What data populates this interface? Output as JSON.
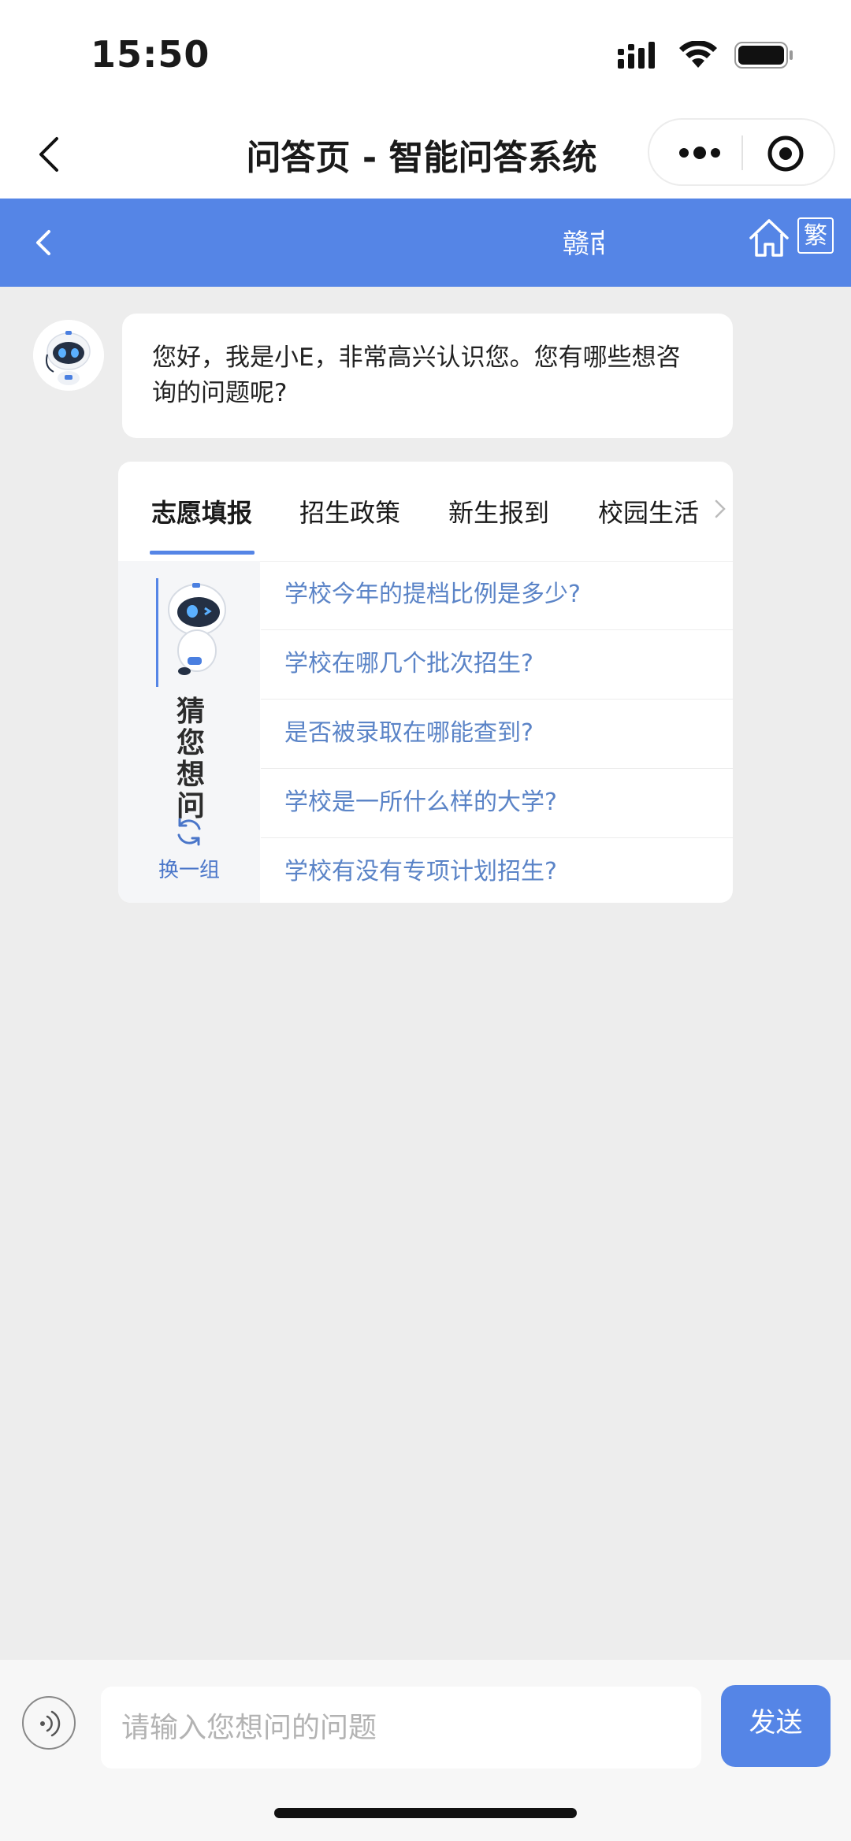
{
  "status_bar": {
    "time": "15:50"
  },
  "nav": {
    "title": "问答页 - 智能问答系统"
  },
  "banner": {
    "title": "赣南",
    "traditional_label": "繁"
  },
  "welcome": {
    "message": "您好，我是小E，非常高兴认识您。您有哪些想咨询的问题呢?"
  },
  "card": {
    "tabs": [
      {
        "label": "志愿填报",
        "active": true
      },
      {
        "label": "招生政策",
        "active": false
      },
      {
        "label": "新生报到",
        "active": false
      },
      {
        "label": "校园生活",
        "active": false
      }
    ],
    "guess_chars": [
      "猜",
      "您",
      "想",
      "问"
    ],
    "refresh_label": "换一组",
    "questions": [
      "学校今年的提档比例是多少?",
      "学校在哪几个批次招生?",
      "是否被录取在哪能查到?",
      "学校是一所什么样的大学?",
      "学校有没有专项计划招生?"
    ]
  },
  "input": {
    "placeholder": "请输入您想问的问题",
    "send_label": "发送"
  },
  "colors": {
    "accent": "#5585e6",
    "question_text": "#5b84c7",
    "background": "#ededed"
  },
  "icons": [
    "back-arrow-icon",
    "more-dots-icon",
    "target-icon",
    "home-icon",
    "chevron-right-icon",
    "refresh-icon",
    "voice-icon",
    "robot-avatar",
    "signal-icon",
    "wifi-icon",
    "battery-icon"
  ]
}
